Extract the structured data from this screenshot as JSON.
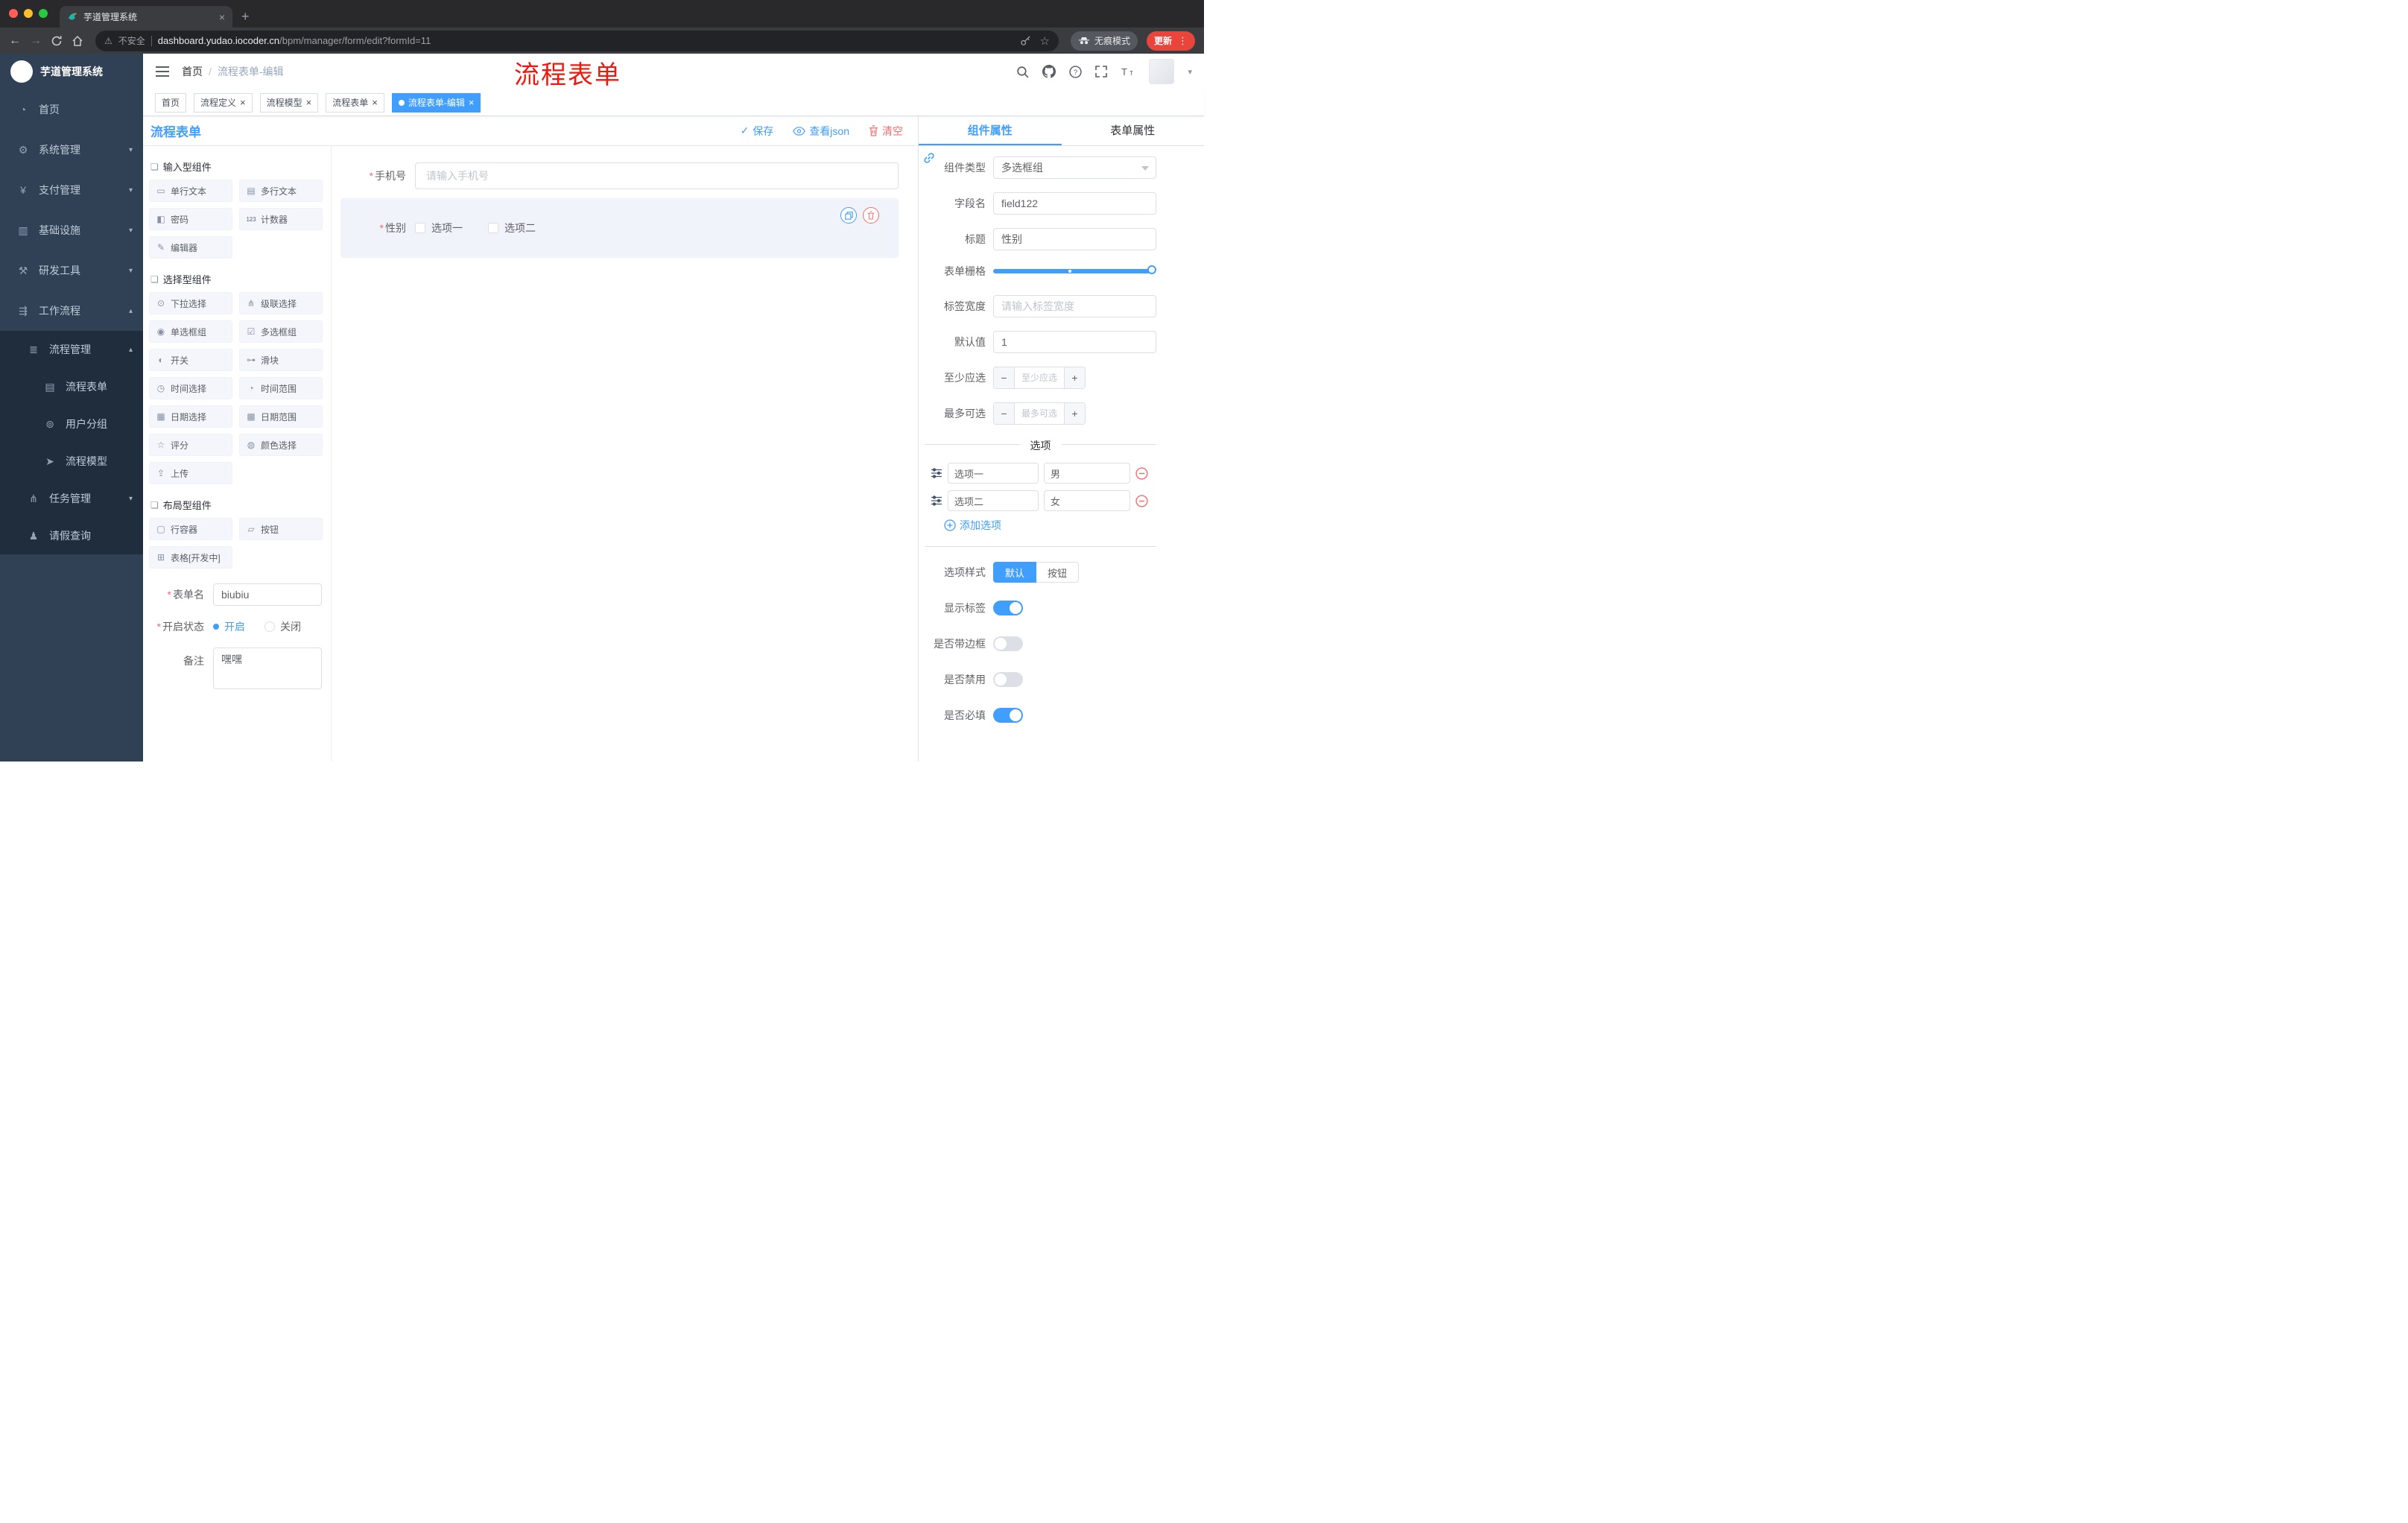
{
  "browser": {
    "tab_title": "芋道管理系统",
    "security_label": "不安全",
    "url_domain": "dashboard.yudao.iocoder.cn",
    "url_path": "/bpm/manager/form/edit?formId=11",
    "incognito_label": "无痕模式",
    "update_label": "更新"
  },
  "sidebar": {
    "logo_title": "芋道管理系统",
    "items": [
      {
        "label": "首页",
        "icon": "◔"
      },
      {
        "label": "系统管理",
        "icon": "⚙"
      },
      {
        "label": "支付管理",
        "icon": "¥"
      },
      {
        "label": "基础设施",
        "icon": "▥"
      },
      {
        "label": "研发工具",
        "icon": "⚒"
      },
      {
        "label": "工作流程",
        "icon": "⇶"
      },
      {
        "label": "流程管理",
        "icon": "≣"
      },
      {
        "label": "流程表单",
        "icon": "▤"
      },
      {
        "label": "用户分组",
        "icon": "⊚"
      },
      {
        "label": "流程模型",
        "icon": "➤"
      },
      {
        "label": "任务管理",
        "icon": "⋔"
      },
      {
        "label": "请假查询",
        "icon": "♟"
      }
    ]
  },
  "header": {
    "breadcrumb_home": "首页",
    "breadcrumb_separator": "/",
    "breadcrumb_current": "流程表单-编辑",
    "annotation": "流程表单"
  },
  "tags": {
    "items": [
      {
        "label": "首页"
      },
      {
        "label": "流程定义"
      },
      {
        "label": "流程模型"
      },
      {
        "label": "流程表单"
      },
      {
        "label": "流程表单-编辑"
      }
    ]
  },
  "toolbar": {
    "title": "流程表单",
    "save_label": "保存",
    "view_json_label": "查看json",
    "clear_label": "清空"
  },
  "palette": {
    "sections": [
      {
        "title": "输入型组件",
        "items": [
          {
            "label": "单行文本",
            "icon": "▭"
          },
          {
            "label": "多行文本",
            "icon": "▤"
          },
          {
            "label": "密码",
            "icon": "◧"
          },
          {
            "label": "计数器",
            "icon": "123"
          },
          {
            "label": "编辑器",
            "icon": "✎"
          }
        ]
      },
      {
        "title": "选择型组件",
        "items": [
          {
            "label": "下拉选择",
            "icon": "⊙"
          },
          {
            "label": "级联选择",
            "icon": "⋔"
          },
          {
            "label": "单选框组",
            "icon": "◉"
          },
          {
            "label": "多选框组",
            "icon": "☑"
          },
          {
            "label": "开关",
            "icon": "◐"
          },
          {
            "label": "滑块",
            "icon": "⊶"
          },
          {
            "label": "时间选择",
            "icon": "◷"
          },
          {
            "label": "时间范围",
            "icon": "◔"
          },
          {
            "label": "日期选择",
            "icon": "▦"
          },
          {
            "label": "日期范围",
            "icon": "▩"
          },
          {
            "label": "评分",
            "icon": "☆"
          },
          {
            "label": "颜色选择",
            "icon": "◍"
          },
          {
            "label": "上传",
            "icon": "⇪"
          }
        ]
      },
      {
        "title": "布局型组件",
        "items": [
          {
            "label": "行容器",
            "icon": "▢"
          },
          {
            "label": "按钮",
            "icon": "▱"
          },
          {
            "label": "表格[开发中]",
            "icon": "⊞"
          }
        ]
      }
    ],
    "form": {
      "name_label": "表单名",
      "name_value": "biubiu",
      "status_label": "开启状态",
      "status_on": "开启",
      "status_off": "关闭",
      "remark_label": "备注",
      "remark_value": "嘿嘿"
    }
  },
  "canvas": {
    "phone_label": "手机号",
    "phone_placeholder": "请输入手机号",
    "gender_label": "性别",
    "gender_option1": "选项一",
    "gender_option2": "选项二"
  },
  "props": {
    "tab_component": "组件属性",
    "tab_form": "表单属性",
    "type_label": "组件类型",
    "type_value": "多选框组",
    "field_label": "字段名",
    "field_value": "field122",
    "title_label": "标题",
    "title_value": "性别",
    "grid_label": "表单栅格",
    "label_width_label": "标签宽度",
    "label_width_placeholder": "请输入标签宽度",
    "default_label": "默认值",
    "default_value": "1",
    "min_label": "至少应选",
    "min_placeholder": "至少应选",
    "max_label": "最多可选",
    "max_placeholder": "最多可选",
    "options_divider": "选项",
    "option_rows": [
      {
        "label": "选项一",
        "value": "男"
      },
      {
        "label": "选项二",
        "value": "女"
      }
    ],
    "add_option_label": "添加选项",
    "style_label": "选项样式",
    "style_default": "默认",
    "style_button": "按钮",
    "switch_show_label": "显示标签",
    "switch_border": "是否带边框",
    "switch_disabled": "是否禁用",
    "switch_required": "是否必填"
  },
  "colors": {
    "accent": "#409eff",
    "danger": "#f56c6c",
    "sidebar": "#304156",
    "sidebar_sub": "#1f2d3d",
    "annotation_red": "#f3160b"
  }
}
